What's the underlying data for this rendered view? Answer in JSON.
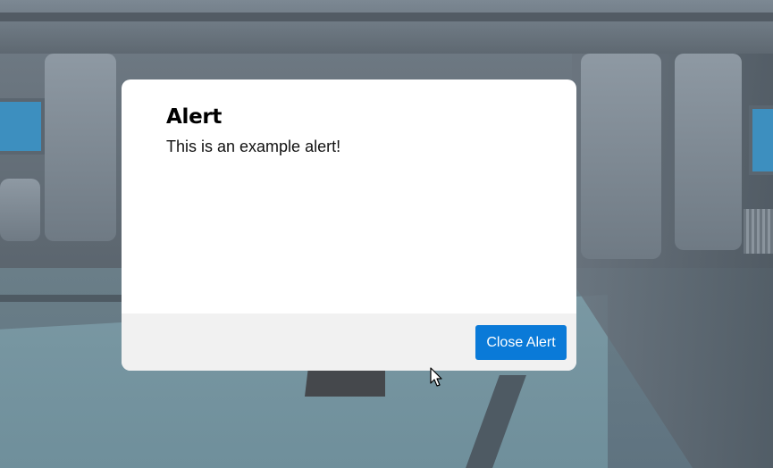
{
  "alert": {
    "title": "Alert",
    "message": "This is an example alert!",
    "close_label": "Close Alert"
  },
  "colors": {
    "button_bg": "#0a7ad8",
    "footer_bg": "#f1f1f1",
    "modal_bg": "#ffffff"
  },
  "icons": {
    "cursor": "mouse-pointer-icon"
  }
}
